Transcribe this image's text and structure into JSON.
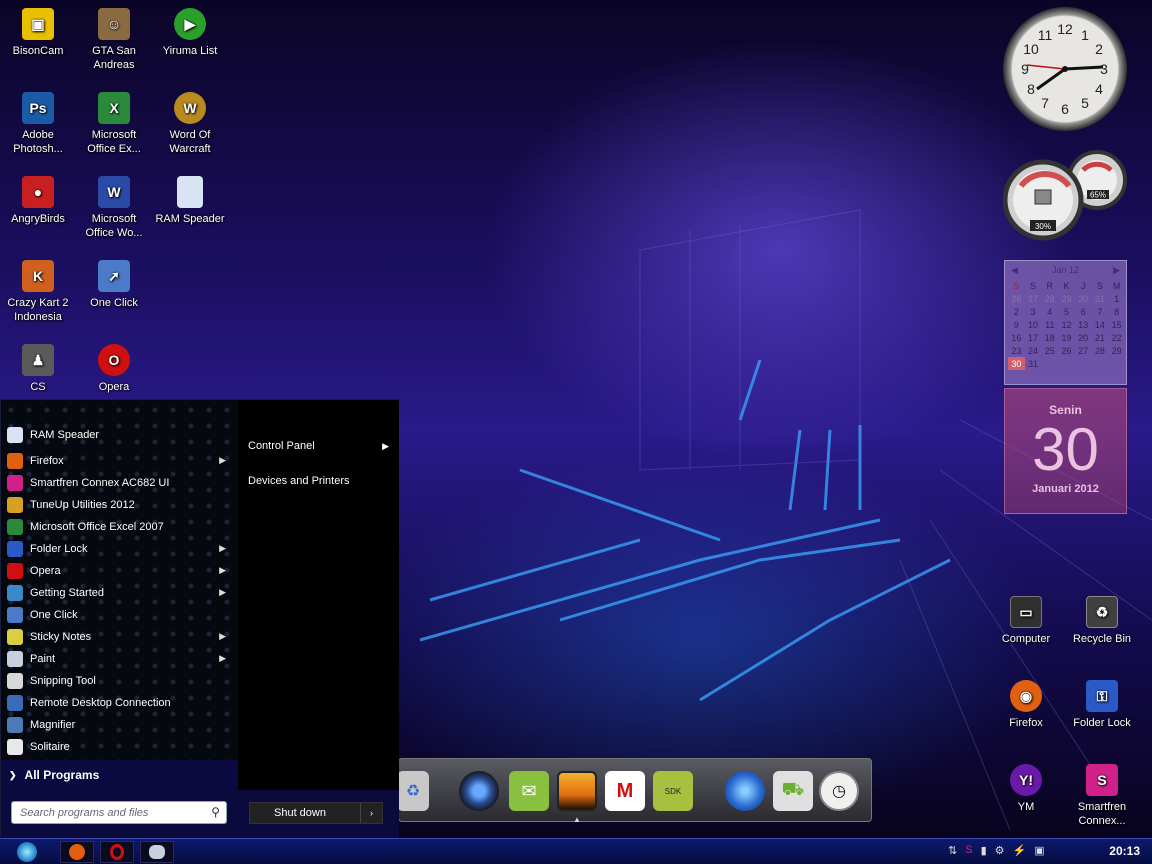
{
  "desktop_icons": [
    {
      "id": "bisoncam",
      "label": "BisonCam",
      "icon": "camera-icon",
      "color": "#e8c000"
    },
    {
      "id": "gta",
      "label": "GTA San Andreas",
      "icon": "gta-icon",
      "color": "#8a6a40"
    },
    {
      "id": "yiruma",
      "label": "Yiruma List",
      "icon": "play-icon",
      "color": "#2aa02a"
    },
    {
      "id": "photoshop",
      "label": "Adobe Photosh...",
      "icon": "photoshop-icon",
      "color": "#1a5aa8"
    },
    {
      "id": "excel",
      "label": "Microsoft Office Ex...",
      "icon": "excel-icon",
      "color": "#2a8a3a"
    },
    {
      "id": "wow",
      "label": "Word Of Warcraft",
      "icon": "warcraft-icon",
      "color": "#b88a20"
    },
    {
      "id": "angrybirds",
      "label": "AngryBirds",
      "icon": "angrybirds-icon",
      "color": "#c82020"
    },
    {
      "id": "word",
      "label": "Microsoft Office Wo...",
      "icon": "word-icon",
      "color": "#2a4aa8"
    },
    {
      "id": "ramspeader",
      "label": "RAM Speader",
      "icon": "file-icon",
      "color": "#d8e4f4"
    },
    {
      "id": "crazykart",
      "label": "Crazy Kart 2 Indonesia",
      "icon": "crazykart-icon",
      "color": "#d06020"
    },
    {
      "id": "oneclick",
      "label": "One Click",
      "icon": "oneclick-icon",
      "color": "#4a7ac8"
    },
    {
      "id": "cs",
      "label": "CS",
      "icon": "counterstrike-icon",
      "color": "#5a5a5a"
    },
    {
      "id": "opera",
      "label": "Opera",
      "icon": "opera-icon",
      "color": "#d01010"
    },
    {
      "id": "computer",
      "label": "Computer",
      "icon": "computer-icon",
      "color": "#303030"
    },
    {
      "id": "recyclebin",
      "label": "Recycle Bin",
      "icon": "recycle-bin-icon",
      "color": "#404040"
    },
    {
      "id": "firefox",
      "label": "Firefox",
      "icon": "firefox-icon",
      "color": "#e06010"
    },
    {
      "id": "folderlock",
      "label": "Folder Lock",
      "icon": "folderlock-icon",
      "color": "#2a5ac8"
    },
    {
      "id": "ym",
      "label": "YM",
      "icon": "yahoo-messenger-icon",
      "color": "#6a1aa8"
    },
    {
      "id": "smartfren",
      "label": "Smartfren Connex...",
      "icon": "smartfren-icon",
      "color": "#d0208a"
    }
  ],
  "start_menu": {
    "programs": [
      {
        "label": "RAM Speader",
        "icon": "file-icon",
        "color": "#d8e4f4",
        "submenu": false
      },
      {
        "label": "Firefox",
        "icon": "firefox-icon",
        "color": "#e06010",
        "submenu": true
      },
      {
        "label": "Smartfren Connex AC682 UI",
        "icon": "smartfren-icon",
        "color": "#d0208a",
        "submenu": false
      },
      {
        "label": "TuneUp Utilities 2012",
        "icon": "tuneup-icon",
        "color": "#d8a020",
        "submenu": false
      },
      {
        "label": "Microsoft Office Excel 2007",
        "icon": "excel-icon",
        "color": "#2a8a3a",
        "submenu": false
      },
      {
        "label": "Folder Lock",
        "icon": "folderlock-icon",
        "color": "#2a5ac8",
        "submenu": true
      },
      {
        "label": "Opera",
        "icon": "opera-icon",
        "color": "#d01010",
        "submenu": true
      },
      {
        "label": "Getting Started",
        "icon": "getting-started-icon",
        "color": "#3a8ac8",
        "submenu": true
      },
      {
        "label": "One Click",
        "icon": "oneclick-icon",
        "color": "#4a7ac8",
        "submenu": false
      },
      {
        "label": "Sticky Notes",
        "icon": "sticky-notes-icon",
        "color": "#d8d040",
        "submenu": true
      },
      {
        "label": "Paint",
        "icon": "paint-icon",
        "color": "#c8d0e0",
        "submenu": true
      },
      {
        "label": "Snipping Tool",
        "icon": "snipping-tool-icon",
        "color": "#d8d8d8",
        "submenu": false
      },
      {
        "label": "Remote Desktop Connection",
        "icon": "remote-desktop-icon",
        "color": "#3a6ab8",
        "submenu": false
      },
      {
        "label": "Magnifier",
        "icon": "magnifier-icon",
        "color": "#4a7ab8",
        "submenu": false
      },
      {
        "label": "Solitaire",
        "icon": "solitaire-icon",
        "color": "#e8e8e8",
        "submenu": false
      }
    ],
    "all_programs": "All Programs",
    "right_items": [
      {
        "label": "Control Panel",
        "submenu": true
      },
      {
        "label": "Devices and Printers",
        "submenu": false
      }
    ],
    "search_placeholder": "Search programs and files",
    "shutdown_label": "Shut down"
  },
  "dock": [
    {
      "icon": "recycle-bin-icon",
      "color": "#c8c8c8"
    },
    {
      "icon": "speaker-icon",
      "color": "#2a4a90"
    },
    {
      "icon": "messages-icon",
      "color": "#8ac040"
    },
    {
      "icon": "photos-icon",
      "color": "#d09020"
    },
    {
      "icon": "gmail-icon",
      "color": "#ffffff"
    },
    {
      "icon": "android-sdk-icon",
      "color": "#a8c040"
    },
    {
      "icon": "globe-icon",
      "color": "#2a6ad0"
    },
    {
      "icon": "android-market-icon",
      "color": "#e0e0e0"
    },
    {
      "icon": "clock-icon",
      "color": "#f0f0f0"
    }
  ],
  "gadgets": {
    "clock_numbers": [
      "12",
      "1",
      "2",
      "3",
      "4",
      "5",
      "6",
      "7",
      "8",
      "9",
      "10",
      "11"
    ],
    "cpu_percent": "30%",
    "ram_percent": "65%",
    "calendar": {
      "month": "Jan 12",
      "weekdays": [
        "S",
        "S",
        "R",
        "K",
        "J",
        "S",
        "M"
      ],
      "rows": [
        [
          "26",
          "27",
          "28",
          "29",
          "30",
          "31",
          "1"
        ],
        [
          "2",
          "3",
          "4",
          "5",
          "6",
          "7",
          "8"
        ],
        [
          "9",
          "10",
          "11",
          "12",
          "13",
          "14",
          "15"
        ],
        [
          "16",
          "17",
          "18",
          "19",
          "20",
          "21",
          "22"
        ],
        [
          "23",
          "24",
          "25",
          "26",
          "27",
          "28",
          "29"
        ],
        [
          "30",
          "31",
          "",
          "",
          "",
          "",
          ""
        ]
      ],
      "day_name": "Senin",
      "day_number": "30",
      "month_year": "Januari 2012"
    }
  },
  "taskbar": {
    "pinned": [
      {
        "icon": "firefox-icon",
        "color": "#e06010"
      },
      {
        "icon": "opera-icon",
        "color": "#d01010"
      },
      {
        "icon": "paint-icon",
        "color": "#c8d0e0"
      }
    ],
    "time": "20:13"
  }
}
